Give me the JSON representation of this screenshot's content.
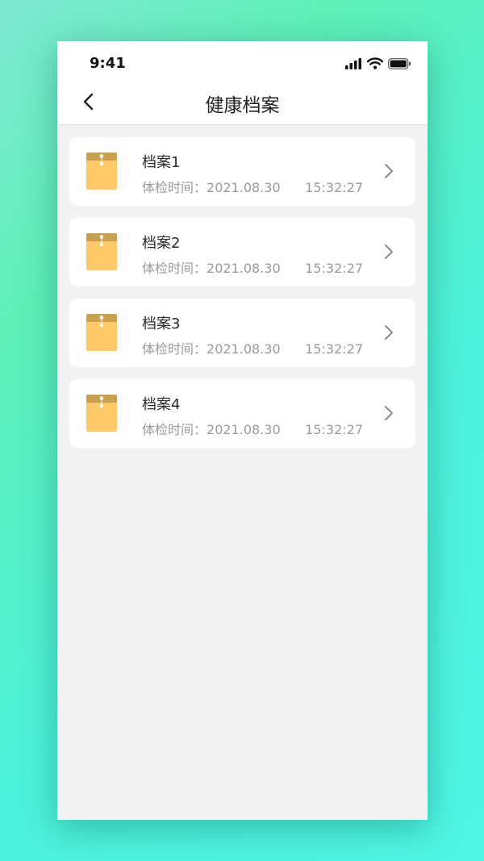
{
  "status_bar": {
    "time": "9:41",
    "icons": [
      "signal-icon",
      "wifi-icon",
      "battery-icon"
    ]
  },
  "header": {
    "title": "健康档案",
    "back_icon": "chevron-left-icon"
  },
  "records": [
    {
      "name": "档案1",
      "time_label": "体检时间：",
      "date": "2021.08.30",
      "clock": "15:32:27"
    },
    {
      "name": "档案2",
      "time_label": "体检时间：",
      "date": "2021.08.30",
      "clock": "15:32:27"
    },
    {
      "name": "档案3",
      "time_label": "体检时间：",
      "date": "2021.08.30",
      "clock": "15:32:27"
    },
    {
      "name": "档案4",
      "time_label": "体检时间：",
      "date": "2021.08.30",
      "clock": "15:32:27"
    }
  ],
  "colors": {
    "folder_body": "#ffc96a",
    "folder_flap": "#c9a04d",
    "page_bg": "#f2f2f2",
    "card_bg": "#ffffff"
  }
}
